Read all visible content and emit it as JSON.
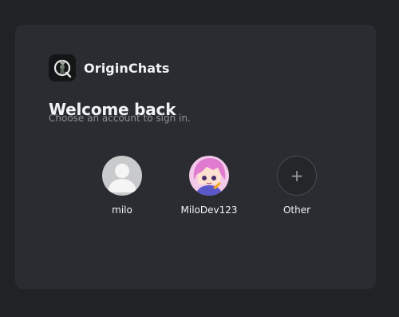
{
  "app": {
    "name": "OriginChats"
  },
  "heading": {
    "title": "Welcome back",
    "subtitle": "Choose an account to sign in."
  },
  "accounts": [
    {
      "label": "milo",
      "avatar_icon": "default-user-icon"
    },
    {
      "label": "MiloDev123",
      "avatar_icon": "anime-avatar-image"
    },
    {
      "label": "Other",
      "avatar_icon": "plus-icon"
    }
  ],
  "icons": {
    "plus": "+"
  },
  "colors": {
    "background": "#212226",
    "card": "#2b2c31",
    "text": "#f2f3f5",
    "muted": "#8d9097"
  }
}
